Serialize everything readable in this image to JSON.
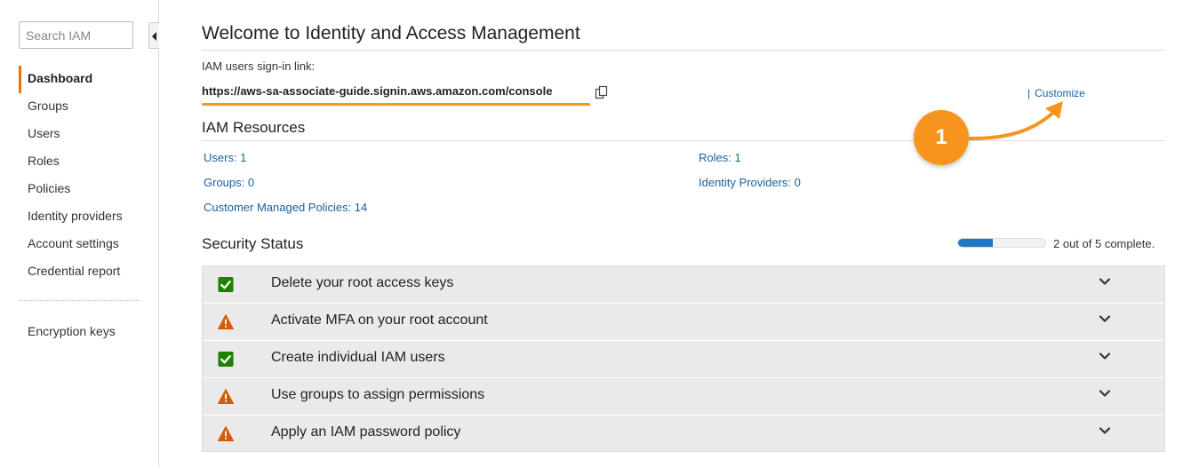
{
  "sidebar": {
    "search_placeholder": "Search IAM",
    "items": [
      {
        "label": "Dashboard",
        "active": true
      },
      {
        "label": "Groups"
      },
      {
        "label": "Users"
      },
      {
        "label": "Roles"
      },
      {
        "label": "Policies"
      },
      {
        "label": "Identity providers"
      },
      {
        "label": "Account settings"
      },
      {
        "label": "Credential report"
      }
    ],
    "secondary_items": [
      {
        "label": "Encryption keys"
      }
    ]
  },
  "main": {
    "title": "Welcome to Identity and Access Management",
    "signin_label": "IAM users sign-in link:",
    "signin_url": "https://aws-sa-associate-guide.signin.aws.amazon.com/console",
    "customize_label": "Customize",
    "annotation_number": "1",
    "resources": {
      "title": "IAM Resources",
      "users": "Users: 1",
      "groups": "Groups: 0",
      "policies": "Customer Managed Policies: 14",
      "roles": "Roles: 1",
      "identity_providers": "Identity Providers: 0"
    },
    "security": {
      "title": "Security Status",
      "progress_fraction": 0.4,
      "progress_text": "2 out of 5 complete.",
      "items": [
        {
          "label": "Delete your root access keys",
          "status": "complete"
        },
        {
          "label": "Activate MFA on your root account",
          "status": "warning"
        },
        {
          "label": "Create individual IAM users",
          "status": "complete"
        },
        {
          "label": "Use groups to assign permissions",
          "status": "warning"
        },
        {
          "label": "Apply an IAM password policy",
          "status": "warning"
        }
      ]
    }
  },
  "colors": {
    "accent": "#ec7211",
    "link": "#1a5f9e",
    "check_green": "#1d8102",
    "warning_orange": "#d45b07",
    "badge_orange": "#f7941d",
    "progress_blue": "#1f78c4"
  }
}
